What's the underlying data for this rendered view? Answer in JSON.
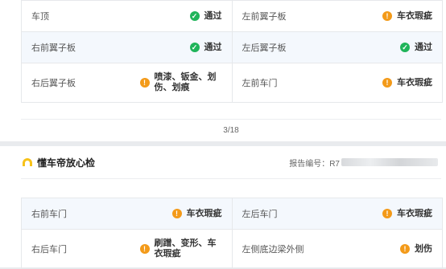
{
  "top": {
    "rows": [
      {
        "left": {
          "label": "车顶",
          "status": "ok",
          "result": "通过"
        },
        "right": {
          "label": "左前翼子板",
          "status": "warn",
          "result": "车衣瑕疵"
        }
      },
      {
        "left": {
          "label": "右前翼子板",
          "status": "ok",
          "result": "通过"
        },
        "right": {
          "label": "左后翼子板",
          "status": "ok",
          "result": "通过"
        }
      },
      {
        "left": {
          "label": "右后翼子板",
          "status": "warn",
          "result": "喷漆、钣金、划伤、划痕"
        },
        "right": {
          "label": "左前车门",
          "status": "warn",
          "result": "车衣瑕疵"
        }
      }
    ],
    "page_indicator": "3/18"
  },
  "header": {
    "brand": "懂车帝放心检",
    "report_label": "报告编号：R7"
  },
  "bottom": {
    "rows": [
      {
        "left": {
          "label": "右前车门",
          "status": "warn",
          "result": "车衣瑕疵"
        },
        "right": {
          "label": "左后车门",
          "status": "warn",
          "result": "车衣瑕疵"
        }
      },
      {
        "left": {
          "label": "右后车门",
          "status": "warn",
          "result": "刷蹭、变形、车衣瑕疵"
        },
        "right": {
          "label": "左侧底边梁外侧",
          "status": "warn",
          "result": "划伤"
        }
      }
    ]
  },
  "colors": {
    "ok": "#20b45a",
    "warn": "#f39a19",
    "alt_row": "#f4f8fd"
  },
  "icons": {
    "ok": "check-circle-icon",
    "warn": "exclamation-circle-icon",
    "brand": "helmet-logo-icon"
  }
}
